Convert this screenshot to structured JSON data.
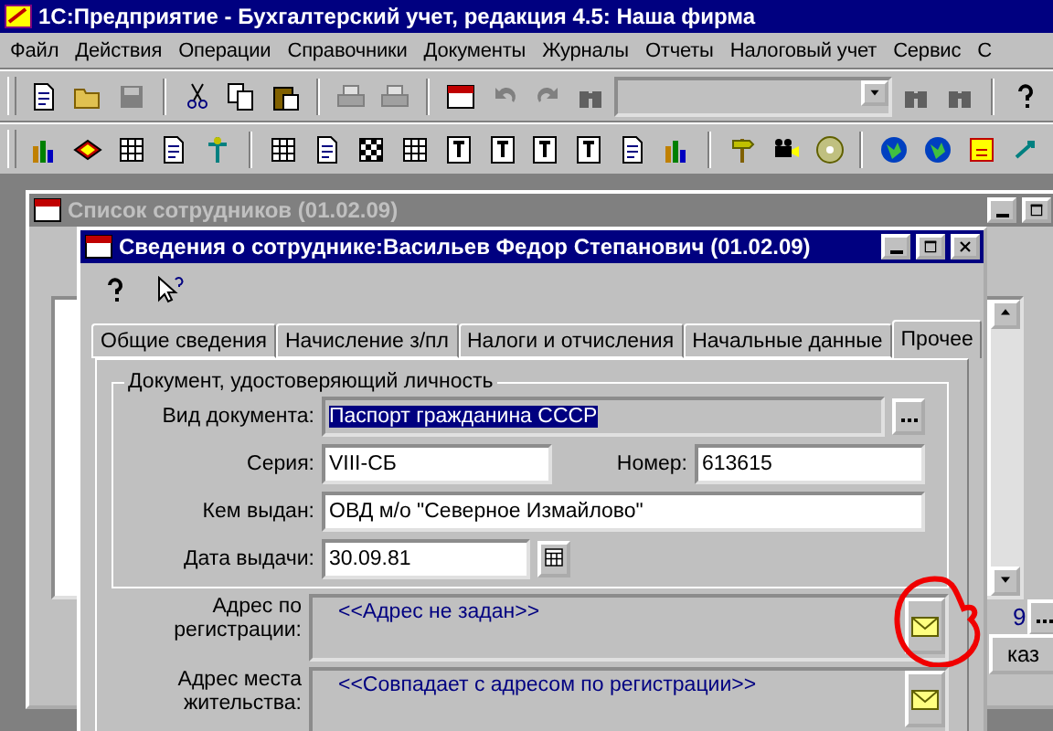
{
  "app_window": {
    "title": "1С:Предприятие - Бухгалтерский учет, редакция 4.5: Наша фирма"
  },
  "menu": [
    {
      "label": "Файл"
    },
    {
      "label": "Действия"
    },
    {
      "label": "Операции"
    },
    {
      "label": "Справочники"
    },
    {
      "label": "Документы"
    },
    {
      "label": "Журналы"
    },
    {
      "label": "Отчеты"
    },
    {
      "label": "Налоговый учет"
    },
    {
      "label": "Сервис"
    },
    {
      "label": "С"
    }
  ],
  "list_window": {
    "title": "Список сотрудников (01.02.09)",
    "cut_text": "9",
    "cut_button": "каз"
  },
  "dialog": {
    "title": "Сведения о сотруднике:Васильев Федор Степанович (01.02.09)",
    "tabs": [
      {
        "label": "Общие сведения",
        "selected": false
      },
      {
        "label": "Начисление з/пл",
        "selected": false
      },
      {
        "label": "Налоги и отчисления",
        "selected": false
      },
      {
        "label": "Начальные данные",
        "selected": false
      },
      {
        "label": "Прочее",
        "selected": true
      }
    ],
    "group": {
      "title": "Документ, удостоверяющий личность",
      "rows": [
        [
          {
            "label": "Вид документа:",
            "value": "Паспорт гражданина СССР",
            "kind": "select",
            "selected": true
          }
        ],
        [
          {
            "label": "Серия:",
            "value": "VIII-СБ",
            "kind": "text",
            "selected": false
          },
          {
            "label": "Номер:",
            "value": "613615",
            "kind": "text",
            "selected": false
          }
        ],
        [
          {
            "label": "Кем выдан:",
            "value": "ОВД м/о \"Северное Измайлово\"",
            "kind": "text",
            "selected": false
          }
        ],
        [
          {
            "label": "Дата выдачи:",
            "value": "30.09.81",
            "kind": "date",
            "selected": false
          }
        ]
      ]
    },
    "addresses": [
      {
        "label": "Адрес по регистрации:",
        "value": "<<Адрес не задан>>",
        "circled": true
      },
      {
        "label": "Адрес места жительства:",
        "value": "<<Совпадает с адресом по регистрации>>",
        "circled": false
      }
    ]
  }
}
